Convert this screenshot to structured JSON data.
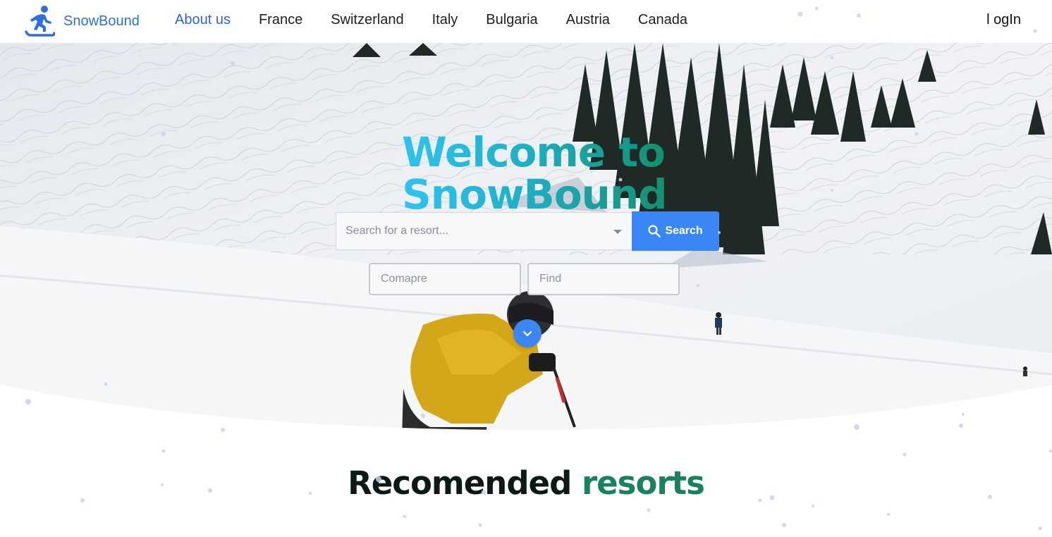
{
  "brand": {
    "name": "SnowBound",
    "icon": "snowboarder-icon"
  },
  "nav": {
    "links": [
      "About us",
      "France",
      "Switzerland",
      "Italy",
      "Bulgaria",
      "Austria",
      "Canada"
    ],
    "active_index": 0,
    "login_label": "l ogIn"
  },
  "hero": {
    "title_line1": "Welcome to",
    "title_line2": "SnowBound",
    "search": {
      "placeholder": "Search for a resort...",
      "button_label": "Search",
      "button_icon": "search-icon"
    },
    "compare_placeholder": "Comapre",
    "find_placeholder": "Find",
    "scroll_icon": "chevron-down-icon"
  },
  "recommended": {
    "title_part1": "Recomended",
    "title_part2": "resorts"
  },
  "colors": {
    "accent": "#3a86f4",
    "brand": "#2f6fd6",
    "title_gradient_start": "#2ec4f0",
    "title_gradient_end": "#138f6c",
    "section_green": "#19825b"
  }
}
